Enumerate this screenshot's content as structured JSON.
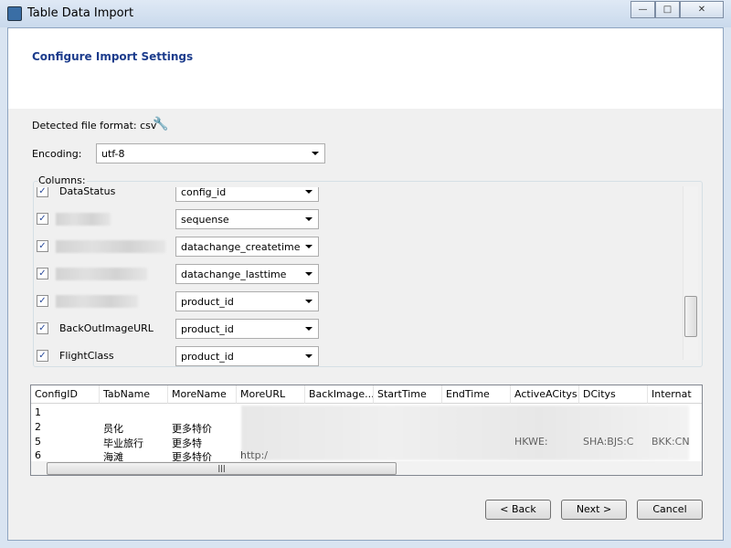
{
  "window": {
    "title": "Table Data Import",
    "minimize": "—",
    "maximize": "□",
    "close": "✕"
  },
  "header": {
    "title": "Configure Import Settings"
  },
  "format": {
    "label": "Detected file format: csv",
    "icon": "wrench-icon"
  },
  "encoding": {
    "label": "Encoding:",
    "value": "utf-8"
  },
  "columns": {
    "label": "Columns:",
    "rows": [
      {
        "checked": true,
        "source": "DataStatus",
        "target": "config_id"
      },
      {
        "checked": true,
        "source": "",
        "target": "sequense"
      },
      {
        "checked": true,
        "source": "",
        "target": "datachange_createtime"
      },
      {
        "checked": true,
        "source": "",
        "target": "datachange_lasttime"
      },
      {
        "checked": true,
        "source": "",
        "target": "product_id"
      },
      {
        "checked": true,
        "source": "BackOutImageURL",
        "target": "product_id"
      },
      {
        "checked": true,
        "source": "FlightClass",
        "target": "product_id"
      }
    ]
  },
  "preview": {
    "headers": [
      "ConfigID",
      "TabName",
      "MoreName",
      "MoreURL",
      "BackImage...",
      "StartTime",
      "EndTime",
      "ActiveACitys",
      "DCitys",
      "Internat"
    ],
    "rows": [
      [
        "1",
        "",
        "",
        "",
        "",
        "",
        "",
        "",
        "",
        ""
      ],
      [
        "2",
        "员化",
        "更多特价",
        "",
        "",
        "",
        "",
        "",
        "",
        ""
      ],
      [
        "5",
        "毕业旅行",
        "更多特",
        "",
        "",
        "",
        "",
        "HKWE:",
        "SHA:BJS:C",
        "BKK:CN"
      ],
      [
        "6",
        "海滩",
        "更多特价",
        "http:/",
        "",
        "",
        "",
        "",
        "",
        ""
      ]
    ]
  },
  "buttons": {
    "back": "< Back",
    "next": "Next >",
    "cancel": "Cancel"
  }
}
